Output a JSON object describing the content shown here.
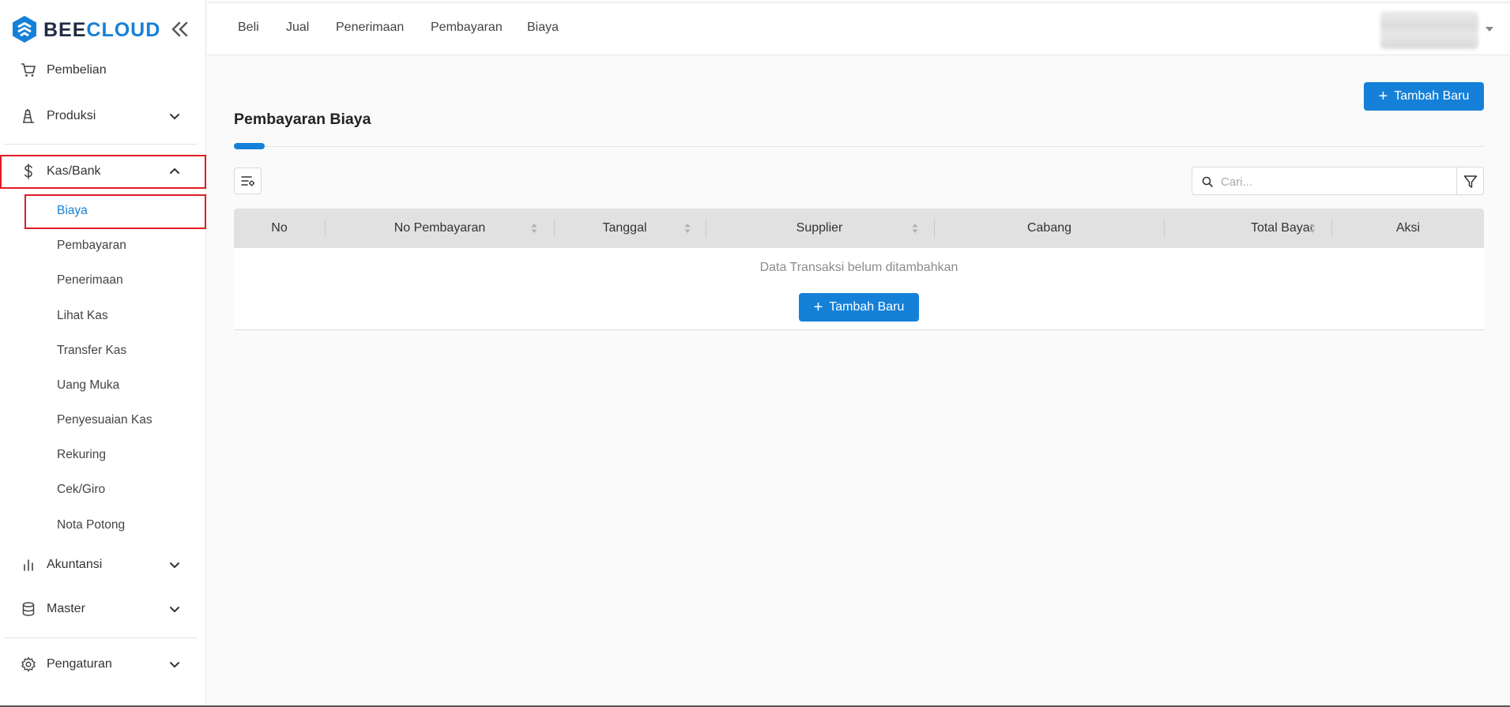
{
  "app": {
    "logo_part1": "BEE",
    "logo_part2": "CLOUD",
    "accent_color": "#1580d8",
    "highlight_color": "#e01b24"
  },
  "sidebar": {
    "items": [
      {
        "label": "Pembelian",
        "icon": "cart-icon"
      },
      {
        "label": "Produksi",
        "icon": "factory-icon"
      },
      {
        "label": "Kas/Bank",
        "icon": "dollar-icon",
        "expanded": true
      },
      {
        "label": "Akuntansi",
        "icon": "bar-chart-icon"
      },
      {
        "label": "Master",
        "icon": "database-icon"
      },
      {
        "label": "Pengaturan",
        "icon": "gear-icon"
      }
    ],
    "sub_items": [
      {
        "label": "Biaya",
        "active": true
      },
      {
        "label": "Pembayaran"
      },
      {
        "label": "Penerimaan"
      },
      {
        "label": "Lihat Kas"
      },
      {
        "label": "Transfer Kas"
      },
      {
        "label": "Uang Muka"
      },
      {
        "label": "Penyesuaian Kas"
      },
      {
        "label": "Rekuring"
      },
      {
        "label": "Cek/Giro"
      },
      {
        "label": "Nota Potong"
      }
    ]
  },
  "topbar": {
    "nav": [
      "Beli",
      "Jual",
      "Penerimaan",
      "Pembayaran",
      "Biaya"
    ]
  },
  "page": {
    "title": "Pembayaran Biaya",
    "add_button": "Tambah Baru",
    "search_placeholder": "Cari...",
    "table": {
      "columns": [
        "No",
        "No Pembayaran",
        "Tanggal",
        "Supplier",
        "Cabang",
        "Total Bayar",
        "Aksi"
      ],
      "empty_message": "Data Transaksi belum ditambahkan",
      "empty_add_button": "Tambah Baru"
    }
  }
}
